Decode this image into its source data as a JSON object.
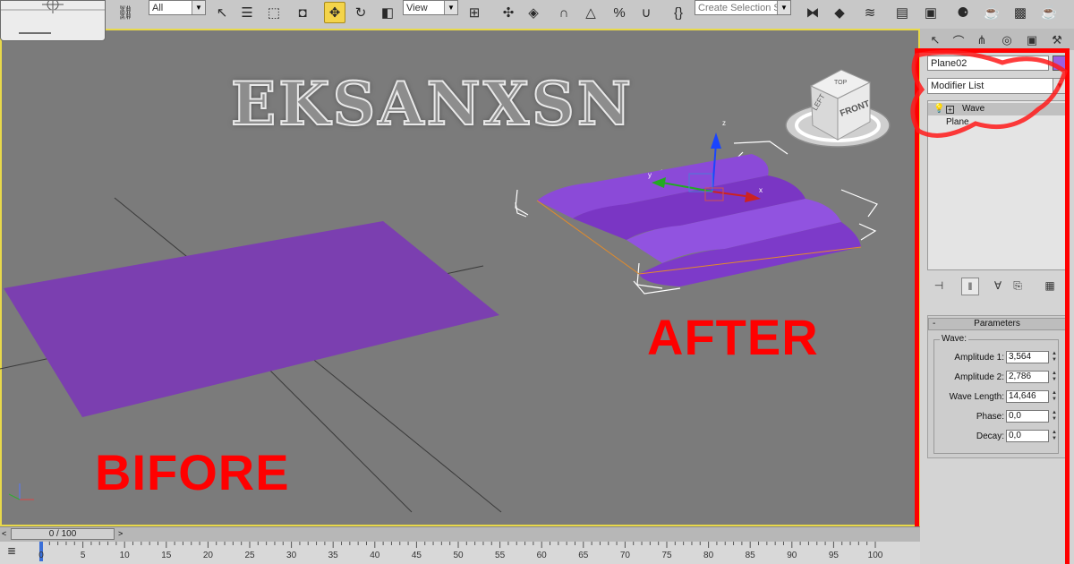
{
  "toolbar": {
    "selection_filter": "All",
    "reference_coord": "View",
    "named_selection_placeholder": "Create Selection Set"
  },
  "viewport": {
    "watermark": "EKSANXSN",
    "label_before": "BIFORE",
    "label_after": "AFTER",
    "viewcube": {
      "top": "TOP",
      "left": "LEFT",
      "front": "FRONT"
    },
    "gizmo_axes": {
      "x": "x",
      "y": "y",
      "z": "z"
    }
  },
  "command_panel": {
    "object_name": "Plane02",
    "object_color": "#9b5fe0",
    "modifier_list": "Modifier List",
    "stack": [
      {
        "label": "Wave",
        "selected": true
      },
      {
        "label": "Plane",
        "selected": false
      }
    ],
    "rollout_title": "Parameters",
    "group_title": "Wave:",
    "params": [
      {
        "label": "Amplitude 1:",
        "value": "3,564"
      },
      {
        "label": "Amplitude 2:",
        "value": "2,786"
      },
      {
        "label": "Wave Length:",
        "value": "14,646"
      },
      {
        "label": "Phase:",
        "value": "0,0"
      },
      {
        "label": "Decay:",
        "value": "0,0"
      }
    ]
  },
  "timeline": {
    "frame_display": "0 / 100",
    "ticks": [
      "0",
      "5",
      "10",
      "15",
      "20",
      "25",
      "30",
      "35",
      "40",
      "45",
      "50",
      "55",
      "60",
      "65",
      "70",
      "75",
      "80",
      "85",
      "90",
      "95",
      "100"
    ]
  },
  "colors": {
    "plane_purple": "#7b3fb0",
    "annotation_red": "#ff0000",
    "viewport_border": "#e8d94a"
  }
}
